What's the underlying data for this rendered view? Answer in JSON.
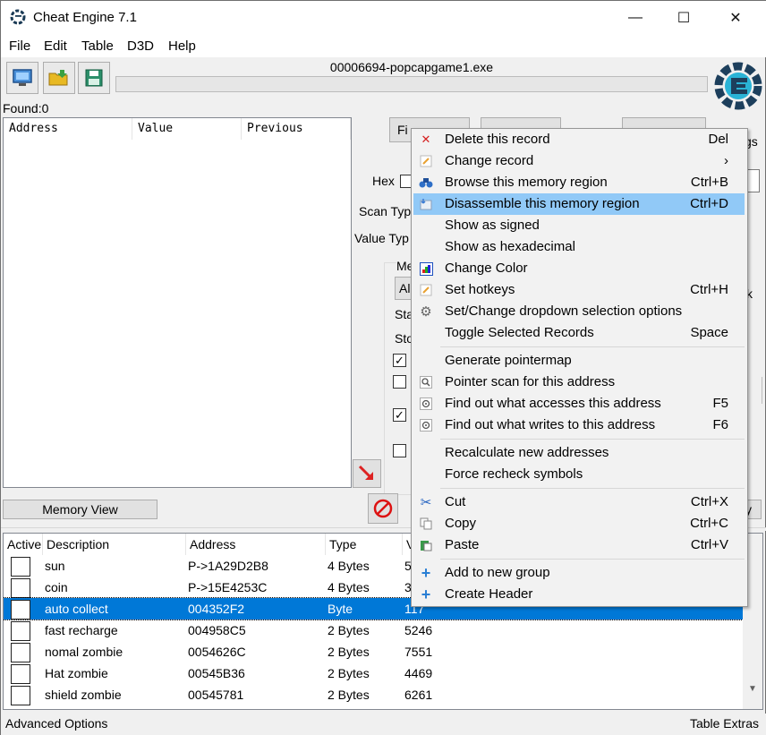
{
  "window": {
    "title": "Cheat Engine 7.1",
    "minimize": "—",
    "maximize": "☐",
    "close": "✕"
  },
  "menu": [
    "File",
    "Edit",
    "Table",
    "D3D",
    "Help"
  ],
  "process_title": "00006694-popcapgame1.exe",
  "found_label": "Found:0",
  "scan_list": {
    "columns": [
      "Address",
      "Value",
      "Previous"
    ]
  },
  "scan_panel": {
    "first_scan_partial": "Fi",
    "hex_label": "Hex",
    "scan_type_partial": "Scan Typ",
    "value_type_partial": "Value Typ",
    "memory_partial": "Me",
    "dropdown_partial": "Al",
    "start_partial": "Sta",
    "stop_partial": "Sto",
    "settings_partial": "gs",
    "k_partial": "k",
    "y_partial": "y"
  },
  "memory_view_button": "Memory View",
  "address_table": {
    "columns": [
      "Active",
      "Description",
      "Address",
      "Type",
      "V"
    ],
    "rows": [
      {
        "description": "sun",
        "address": "P->1A29D2B8",
        "type": "4 Bytes",
        "value": "5"
      },
      {
        "description": "coin",
        "address": "P->15E4253C",
        "type": "4 Bytes",
        "value": "3"
      },
      {
        "description": "auto collect",
        "address": "004352F2",
        "type": "Byte",
        "value": "117"
      },
      {
        "description": "fast recharge",
        "address": "004958C5",
        "type": "2 Bytes",
        "value": "5246"
      },
      {
        "description": "nomal zombie",
        "address": "0054626C",
        "type": "2 Bytes",
        "value": "7551"
      },
      {
        "description": "Hat zombie",
        "address": "00545B36",
        "type": "2 Bytes",
        "value": "4469"
      },
      {
        "description": "shield zombie",
        "address": "00545781",
        "type": "2 Bytes",
        "value": "6261"
      }
    ]
  },
  "status": {
    "left": "Advanced Options",
    "right": "Table Extras"
  },
  "context_menu": {
    "items": [
      {
        "label": "Delete this record",
        "shortcut": "Del",
        "icon": "red-x-icon"
      },
      {
        "label": "Change record",
        "shortcut": "›",
        "icon": "pencil-icon"
      },
      {
        "label": "Browse this memory region",
        "shortcut": "Ctrl+B",
        "icon": "binoculars-icon"
      },
      {
        "label": "Disassemble this memory region",
        "shortcut": "Ctrl+D",
        "icon": "disassemble-icon"
      },
      {
        "label": "Show as signed",
        "shortcut": ""
      },
      {
        "label": "Show as hexadecimal",
        "shortcut": ""
      },
      {
        "label": "Change Color",
        "shortcut": "",
        "icon": "color-icon"
      },
      {
        "label": "Set hotkeys",
        "shortcut": "Ctrl+H",
        "icon": "hotkey-icon"
      },
      {
        "label": "Set/Change dropdown selection options",
        "shortcut": "",
        "icon": "gear-icon"
      },
      {
        "label": "Toggle Selected Records",
        "shortcut": "Space"
      },
      {
        "label": "Generate pointermap",
        "shortcut": ""
      },
      {
        "label": "Pointer scan for this address",
        "shortcut": "",
        "icon": "magnifier-icon"
      },
      {
        "label": "Find out what accesses this address",
        "shortcut": "F5",
        "icon": "find-access-icon"
      },
      {
        "label": "Find out what writes to this address",
        "shortcut": "F6",
        "icon": "find-write-icon"
      },
      {
        "label": "Recalculate new addresses",
        "shortcut": ""
      },
      {
        "label": "Force recheck symbols",
        "shortcut": ""
      },
      {
        "label": "Cut",
        "shortcut": "Ctrl+X",
        "icon": "scissors-icon"
      },
      {
        "label": "Copy",
        "shortcut": "Ctrl+C",
        "icon": "copy-icon"
      },
      {
        "label": "Paste",
        "shortcut": "Ctrl+V",
        "icon": "paste-icon"
      },
      {
        "label": "Add to new group",
        "shortcut": "",
        "icon": "plus-icon"
      },
      {
        "label": "Create Header",
        "shortcut": "",
        "icon": "plus-icon"
      }
    ]
  },
  "colors": {
    "selection": "#0078d7",
    "menu_highlight": "#91c9f7"
  }
}
